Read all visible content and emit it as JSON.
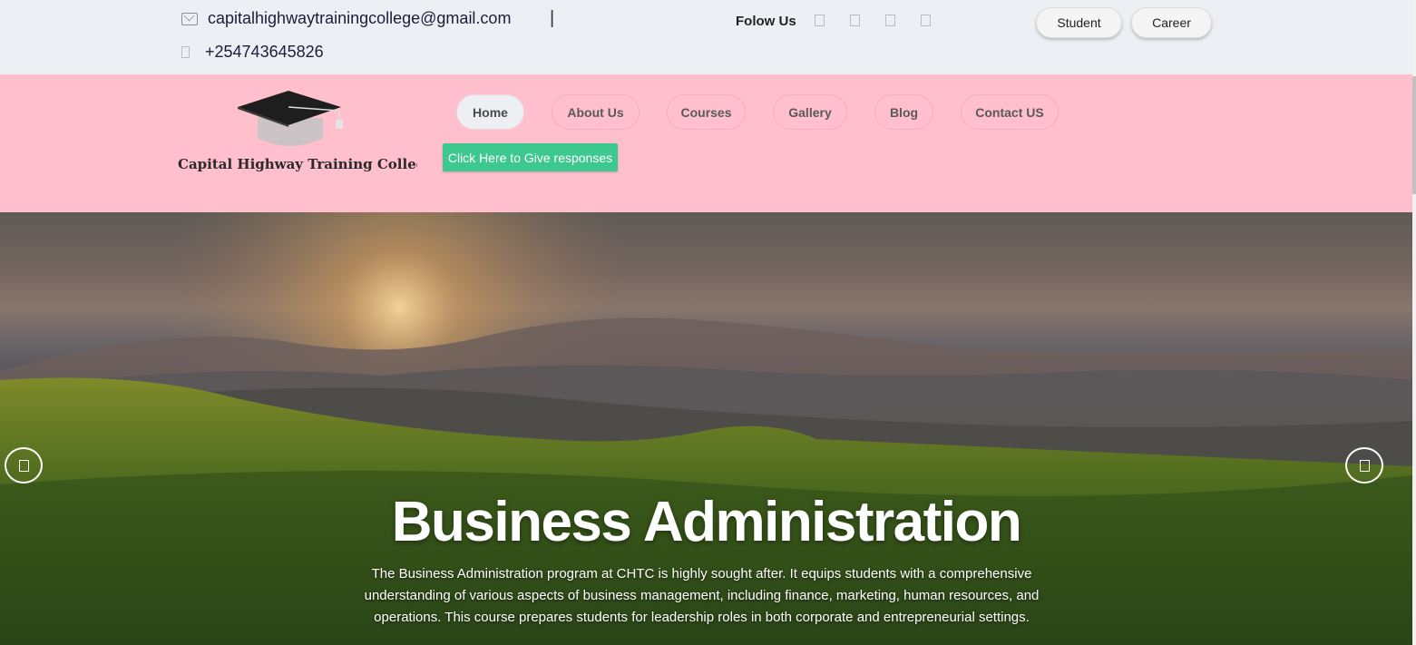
{
  "topbar": {
    "email": "capitalhighwaytrainingcollege@gmail.com",
    "separator": "|",
    "phone": "+254743645826",
    "follow_label": "Folow Us",
    "socials": [
      "social-icon",
      "social-icon",
      "social-icon",
      "social-icon"
    ],
    "student_label": "Student",
    "career_label": "Career"
  },
  "header": {
    "logo_text": "Capital Highway Training College",
    "nav": [
      {
        "label": "Home",
        "active": true
      },
      {
        "label": "About Us",
        "active": false
      },
      {
        "label": "Courses",
        "active": false
      },
      {
        "label": "Gallery",
        "active": false
      },
      {
        "label": "Blog",
        "active": false
      },
      {
        "label": "Contact US",
        "active": false
      }
    ],
    "response_button": "Click Here to Give responses",
    "background": "#ffbfcd",
    "response_color": "#3dc88f"
  },
  "hero": {
    "title": "Business Administration",
    "description": "The Business Administration program at CHTC is highly sought after. It equips students with a comprehensive understanding of various aspects of business management, including finance, marketing, human resources, and operations. This course prepares students for leadership roles in both corporate and entrepreneurial settings.",
    "prev_icon": "chevron-left-icon",
    "next_icon": "chevron-right-icon"
  }
}
